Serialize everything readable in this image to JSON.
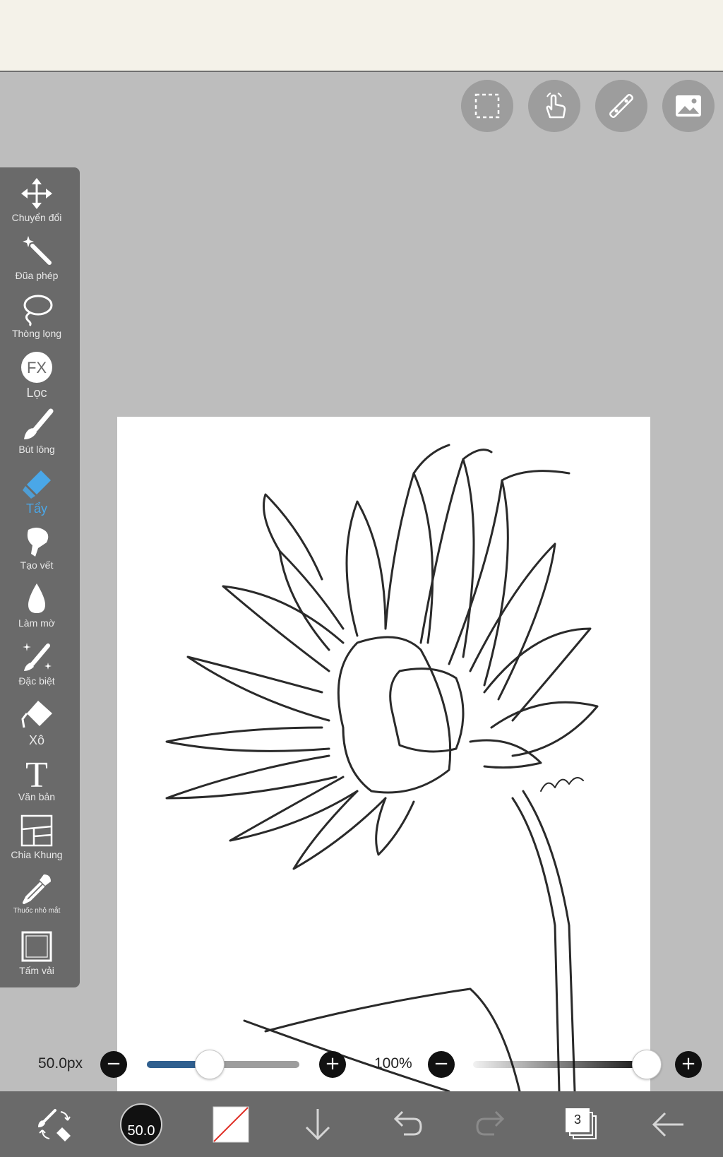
{
  "top_tools": [
    {
      "icon": "selection-icon"
    },
    {
      "icon": "hand-gesture-icon"
    },
    {
      "icon": "ruler-icon"
    },
    {
      "icon": "image-icon"
    }
  ],
  "tools": [
    {
      "label": "Chuyển đổi",
      "icon": "move-arrows-icon"
    },
    {
      "label": "Đũa phép",
      "icon": "magic-wand-icon"
    },
    {
      "label": "Thòng lọng",
      "icon": "lasso-icon"
    },
    {
      "label": "Lọc",
      "icon": "fx-filter-icon"
    },
    {
      "label": "Bút lông",
      "icon": "brush-icon"
    },
    {
      "label": "Tẩy",
      "icon": "eraser-icon"
    },
    {
      "label": "Tạo vết",
      "icon": "smudge-icon"
    },
    {
      "label": "Làm mờ",
      "icon": "blur-drop-icon"
    },
    {
      "label": "Đặc biệt",
      "icon": "special-brush-icon"
    },
    {
      "label": "Xô",
      "icon": "bucket-icon"
    },
    {
      "label": "Văn bản",
      "icon": "text-icon"
    },
    {
      "label": "Chia Khung",
      "icon": "frame-divider-icon"
    },
    {
      "label": "Thuốc nhỏ mắt",
      "icon": "eyedropper-icon"
    },
    {
      "label": "Tấm vải",
      "icon": "canvas-icon"
    }
  ],
  "active_tool": "Tẩy",
  "brush": {
    "size_text": "50.0px",
    "size_fraction": 0.41
  },
  "opacity": {
    "text": "100%",
    "fraction": 1.0
  },
  "bottom": {
    "brush_size_badge": "50.0",
    "layer_count": "3"
  },
  "colors": {
    "accent": "#4aa7e8",
    "panel": "#6a6a6a",
    "slider_fill": "#2f5f8f",
    "background": "#bdbdbd"
  }
}
